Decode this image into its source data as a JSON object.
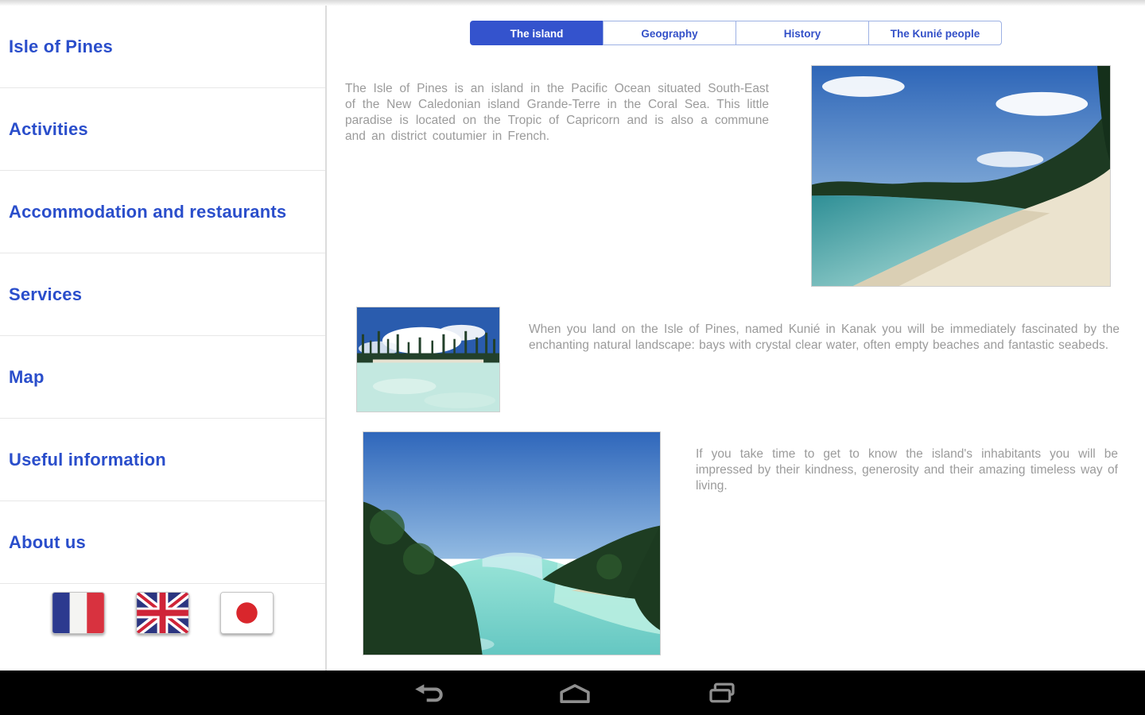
{
  "sidebar": {
    "items": [
      {
        "label": "Isle of Pines"
      },
      {
        "label": "Activities"
      },
      {
        "label": "Accommodation and restaurants"
      },
      {
        "label": "Services"
      },
      {
        "label": "Map"
      },
      {
        "label": "Useful information"
      },
      {
        "label": "About us"
      }
    ],
    "languages": [
      {
        "name": "french-flag"
      },
      {
        "name": "uk-flag"
      },
      {
        "name": "japan-flag"
      }
    ]
  },
  "tabs": [
    {
      "label": "The island",
      "active": true
    },
    {
      "label": "Geography",
      "active": false
    },
    {
      "label": "History",
      "active": false
    },
    {
      "label": "The Kunié people",
      "active": false
    }
  ],
  "content": {
    "paragraphs": [
      {
        "text": "The Isle of Pines is an island in the Pacific Ocean situated South-East of the New Caledonian island Grande-Terre in the Coral Sea. This little paradise is located on the Tropic of Capricorn and is also a commune and an district coutumier in French."
      },
      {
        "text": "When you land on the Isle of Pines, named Kunié in Kanak you will be immediately fascinated by the enchanting natural landscape: bays with crystal clear water, often empty beaches and fantastic seabeds."
      },
      {
        "text": "If you take time to get to know the island's inhabitants you will be impressed by their kindness, generosity and their amazing timeless way of living."
      }
    ],
    "photos": [
      {
        "name": "beach-bay-photo"
      },
      {
        "name": "pine-lagoon-photo"
      },
      {
        "name": "river-channel-photo"
      }
    ]
  },
  "navbar": {
    "icons": [
      {
        "name": "back-icon"
      },
      {
        "name": "home-icon"
      },
      {
        "name": "recents-icon"
      }
    ]
  },
  "colors": {
    "accent_blue": "#3453cd",
    "link_blue": "#2a4ecb",
    "body_gray": "#9b9b9b",
    "navbar_black": "#000000"
  }
}
